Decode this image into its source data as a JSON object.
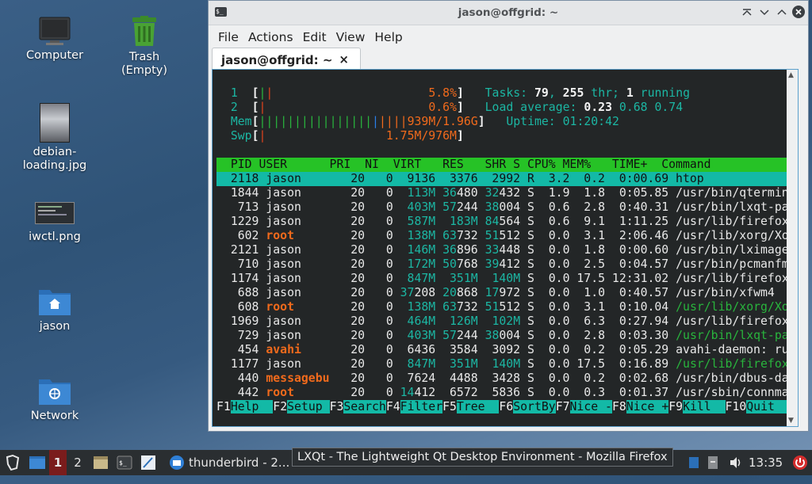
{
  "desktop": {
    "icons": [
      {
        "label": "Computer"
      },
      {
        "label": "Trash\n(Empty)"
      },
      {
        "label": "debian-\nloading.jpg"
      },
      {
        "label": "iwctl.png"
      },
      {
        "label": "jason"
      },
      {
        "label": "Network"
      }
    ]
  },
  "window": {
    "title": "jason@offgrid: ~",
    "menu": [
      "File",
      "Actions",
      "Edit",
      "View",
      "Help"
    ],
    "tab_label": "jason@offgrid: ~",
    "tab_close": "×"
  },
  "htop": {
    "cpu1": {
      "label": "1",
      "value": "5.8%"
    },
    "cpu2": {
      "label": "2",
      "value": "0.6%"
    },
    "mem": {
      "label": "Mem",
      "value": "939M/1.96G"
    },
    "swp": {
      "label": "Swp",
      "value": "1.75M/976M"
    },
    "tasks": {
      "prefix": "Tasks: ",
      "count": "79",
      "sep": ", ",
      "threads": "255",
      "thr": " thr; ",
      "running": "1",
      "running_label": " running"
    },
    "load": {
      "label": "Load average: ",
      "v1": "0.23",
      "v2": "0.68",
      "v3": "0.74"
    },
    "uptime": {
      "label": "Uptime: ",
      "value": "01:20:42"
    },
    "columns": "  PID USER      PRI  NI  VIRT   RES   SHR S CPU% MEM%   TIME+  Command",
    "rows": [
      {
        "pid": "2118",
        "user": "jason",
        "pri": "20",
        "ni": "0",
        "virt": "9136",
        "res": "3376",
        "shr": "2992",
        "s": "R",
        "cpu": "3.2",
        "mem": "0.2",
        "time": "0:00.69",
        "cmd": "htop",
        "selected": true
      },
      {
        "pid": "1844",
        "user": "jason",
        "pri": "20",
        "ni": "0",
        "virt": "113M",
        "res": "36480",
        "shr": "32432",
        "s": "S",
        "cpu": "1.9",
        "mem": "1.8",
        "time": "0:05.85",
        "cmd": "/usr/bin/qtermina"
      },
      {
        "pid": "713",
        "user": "jason",
        "pri": "20",
        "ni": "0",
        "virt": "403M",
        "res": "57244",
        "shr": "38004",
        "s": "S",
        "cpu": "0.6",
        "mem": "2.8",
        "time": "0:40.31",
        "cmd": "/usr/bin/lxqt-pan"
      },
      {
        "pid": "1229",
        "user": "jason",
        "pri": "20",
        "ni": "0",
        "virt": "587M",
        "res": "183M",
        "shr": "84564",
        "s": "S",
        "cpu": "0.6",
        "mem": "9.1",
        "time": "1:11.25",
        "cmd": "/usr/lib/firefox-"
      },
      {
        "pid": "602",
        "user": "root",
        "pri": "20",
        "ni": "0",
        "virt": "138M",
        "res": "63732",
        "shr": "51512",
        "s": "S",
        "cpu": "0.0",
        "mem": "3.1",
        "time": "2:06.46",
        "cmd": "/usr/lib/xorg/Xor"
      },
      {
        "pid": "2121",
        "user": "jason",
        "pri": "20",
        "ni": "0",
        "virt": "146M",
        "res": "36896",
        "shr": "33448",
        "s": "S",
        "cpu": "0.0",
        "mem": "1.8",
        "time": "0:00.60",
        "cmd": "/usr/bin/lximage-"
      },
      {
        "pid": "710",
        "user": "jason",
        "pri": "20",
        "ni": "0",
        "virt": "172M",
        "res": "50768",
        "shr": "39412",
        "s": "S",
        "cpu": "0.0",
        "mem": "2.5",
        "time": "0:04.57",
        "cmd": "/usr/bin/pcmanfm-"
      },
      {
        "pid": "1174",
        "user": "jason",
        "pri": "20",
        "ni": "0",
        "virt": "847M",
        "res": "351M",
        "shr": "140M",
        "s": "S",
        "cpu": "0.0",
        "mem": "17.5",
        "time": "12:31.02",
        "cmd": "/usr/lib/firefox-"
      },
      {
        "pid": "688",
        "user": "jason",
        "pri": "20",
        "ni": "0",
        "virt": "37208",
        "res": "20868",
        "shr": "17972",
        "s": "S",
        "cpu": "0.0",
        "mem": "1.0",
        "time": "0:40.57",
        "cmd": "/usr/bin/xfwm4"
      },
      {
        "pid": "608",
        "user": "root",
        "pri": "20",
        "ni": "0",
        "virt": "138M",
        "res": "63732",
        "shr": "51512",
        "s": "S",
        "cpu": "0.0",
        "mem": "3.1",
        "time": "0:10.04",
        "cmd": "/usr/lib/xorg/Xor",
        "thread": true
      },
      {
        "pid": "1969",
        "user": "jason",
        "pri": "20",
        "ni": "0",
        "virt": "464M",
        "res": "126M",
        "shr": "102M",
        "s": "S",
        "cpu": "0.0",
        "mem": "6.3",
        "time": "0:27.94",
        "cmd": "/usr/lib/firefox-"
      },
      {
        "pid": "729",
        "user": "jason",
        "pri": "20",
        "ni": "0",
        "virt": "403M",
        "res": "57244",
        "shr": "38004",
        "s": "S",
        "cpu": "0.0",
        "mem": "2.8",
        "time": "0:03.30",
        "cmd": "/usr/bin/lxqt-pan",
        "thread": true
      },
      {
        "pid": "454",
        "user": "avahi",
        "pri": "20",
        "ni": "0",
        "virt": "6436",
        "res": "3584",
        "shr": "3092",
        "s": "S",
        "cpu": "0.0",
        "mem": "0.2",
        "time": "0:05.29",
        "cmd": "avahi-daemon: run"
      },
      {
        "pid": "1177",
        "user": "jason",
        "pri": "20",
        "ni": "0",
        "virt": "847M",
        "res": "351M",
        "shr": "140M",
        "s": "S",
        "cpu": "0.0",
        "mem": "17.5",
        "time": "0:16.89",
        "cmd": "/usr/lib/firefox-",
        "thread": true
      },
      {
        "pid": "440",
        "user": "messagebu",
        "pri": "20",
        "ni": "0",
        "virt": "7624",
        "res": "4488",
        "shr": "3428",
        "s": "S",
        "cpu": "0.0",
        "mem": "0.2",
        "time": "0:02.68",
        "cmd": "/usr/bin/dbus-dae"
      },
      {
        "pid": "442",
        "user": "root",
        "pri": "20",
        "ni": "0",
        "virt": "14412",
        "res": "6572",
        "shr": "5836",
        "s": "S",
        "cpu": "0.0",
        "mem": "0.3",
        "time": "0:01.37",
        "cmd": "/usr/sbin/connman"
      }
    ],
    "fkeys": [
      {
        "key": "F1",
        "label": "Help  "
      },
      {
        "key": "F2",
        "label": "Setup "
      },
      {
        "key": "F3",
        "label": "Search"
      },
      {
        "key": "F4",
        "label": "Filter"
      },
      {
        "key": "F5",
        "label": "Tree  "
      },
      {
        "key": "F6",
        "label": "SortBy"
      },
      {
        "key": "F7",
        "label": "Nice -"
      },
      {
        "key": "F8",
        "label": "Nice +"
      },
      {
        "key": "F9",
        "label": "Kill  "
      },
      {
        "key": "F10",
        "label": "Quit  "
      }
    ]
  },
  "taskbar": {
    "desktop1": "1",
    "desktop2": "2",
    "task_thunderbird": "thunderbird - 2...",
    "clock": "13:35"
  },
  "tooltip": "LXQt - The Lightweight Qt Desktop Environment - Mozilla Firefox"
}
